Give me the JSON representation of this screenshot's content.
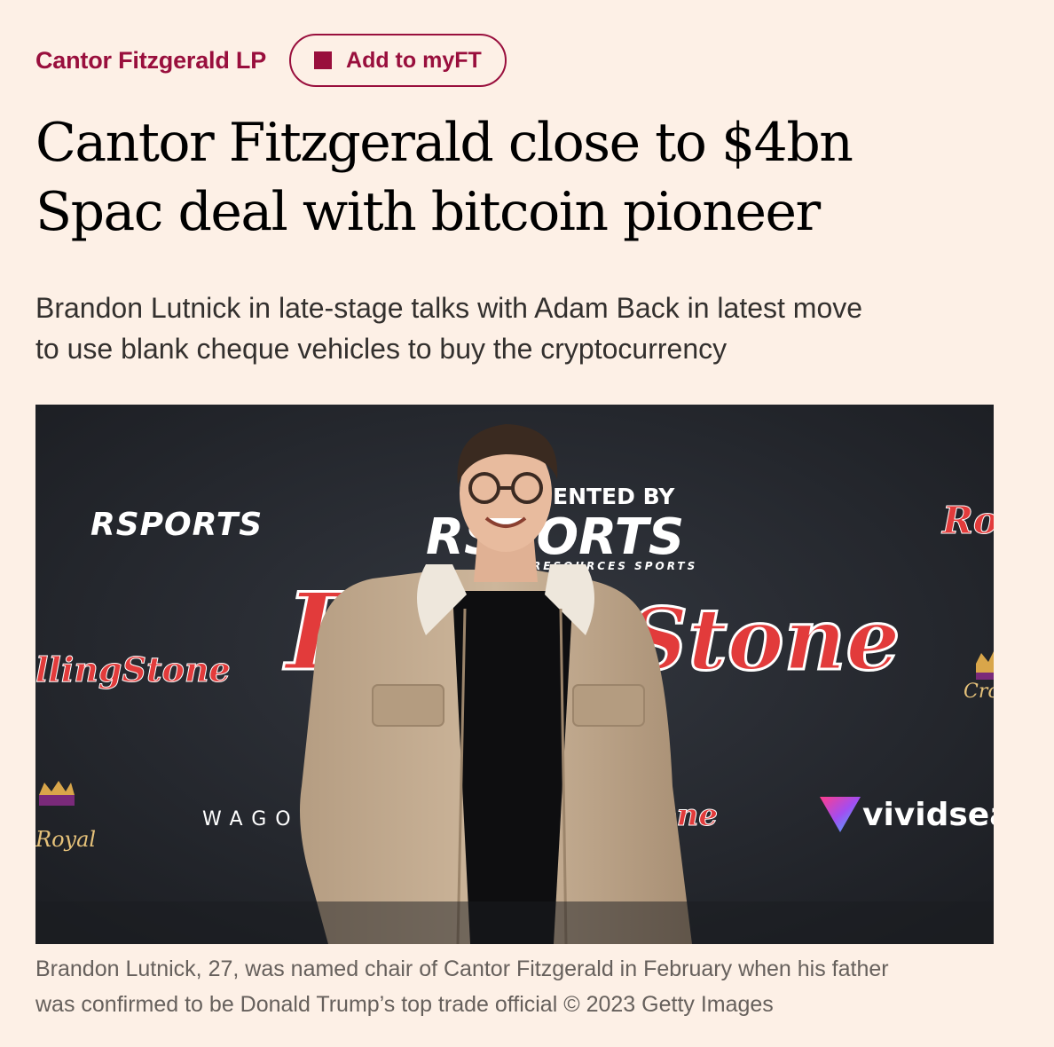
{
  "topic": {
    "label": "Cantor Fitzgerald LP",
    "follow_button": "Add to myFT",
    "accent_color": "#990f3d"
  },
  "article": {
    "headline_line1": "Cantor Fitzgerald close to $4bn",
    "headline_line2": "Spac deal with bitcoin pioneer",
    "standfirst_line1": "Brandon Lutnick in late-stage talks with Adam Back in latest move",
    "standfirst_line2": "to use blank cheque vehicles to buy the cryptocurrency"
  },
  "image": {
    "backdrop_texts": {
      "rsports_left": "RSPORTS",
      "presented_by": "SENTED BY",
      "rsports_center": "RSPORTS",
      "resources_sports": "RESOURCES SPORTS",
      "rolling_stone_left": "llingStone",
      "rolling_stone_center": "Stone",
      "rolling_stone_lower": "one",
      "rolling_stone_right": "Ro",
      "wago": "WAGO",
      "vividseats": "vividsea",
      "royal": "Royal",
      "crown": "Cro"
    },
    "caption_line1": "Brandon Lutnick, 27, was named chair of Cantor Fitzgerald in February when his father",
    "caption_line2": "was confirmed to be Donald Trump’s top trade official © 2023 Getty Images"
  },
  "colors": {
    "page_background": "#fdf0e6",
    "text_primary": "#000000",
    "text_secondary": "#33302e",
    "caption": "#66605c"
  },
  "icons": {
    "myft": "filled-square-icon"
  }
}
